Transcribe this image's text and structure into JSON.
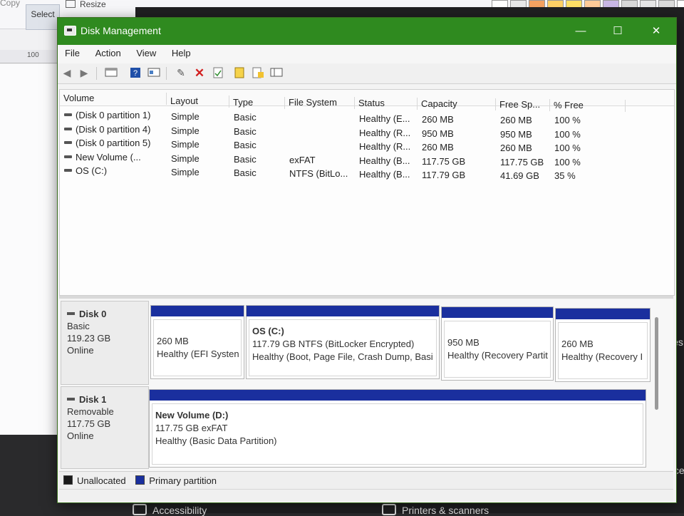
{
  "background_paint": {
    "copy_label": "Copy",
    "select_label": "Select",
    "resize_label": "Resize",
    "ruler_value": "100",
    "palette_colors": [
      "#ffffff",
      "#e9e9e9",
      "#f4a261",
      "#ffd166",
      "#ffe066",
      "#ffcc99",
      "#c9b8e6",
      "#d9d9d9",
      "#e6e6e6",
      "#dcdcdc",
      "#ffffff",
      "#b0b0b0"
    ]
  },
  "background_settings": {
    "side_text_1": "ices",
    "side_text_2": "evice",
    "bottom_item_1": "Accessibility",
    "bottom_item_2": "Printers & scanners"
  },
  "window": {
    "title": "Disk Management",
    "accent_color": "#2f8a1f",
    "icon": "disk-management-icon",
    "minimize": "—",
    "maximize": "☐",
    "close": "✕"
  },
  "menu": [
    "File",
    "Action",
    "View",
    "Help"
  ],
  "toolbar": {
    "icons": [
      "back-arrow-icon",
      "forward-arrow-icon",
      "console-tree-icon",
      "help-icon",
      "properties-icon",
      "connect-icon",
      "delete-icon",
      "check-icon",
      "new-icon",
      "open-icon",
      "list-icon"
    ]
  },
  "volumes": {
    "columns": [
      "Volume",
      "Layout",
      "Type",
      "File System",
      "Status",
      "Capacity",
      "Free Sp...",
      "% Free"
    ],
    "rows": [
      {
        "volume": "(Disk 0 partition 1)",
        "layout": "Simple",
        "type": "Basic",
        "fs": "",
        "status": "Healthy (E...",
        "capacity": "260 MB",
        "free": "260 MB",
        "pct": "100 %"
      },
      {
        "volume": "(Disk 0 partition 4)",
        "layout": "Simple",
        "type": "Basic",
        "fs": "",
        "status": "Healthy (R...",
        "capacity": "950 MB",
        "free": "950 MB",
        "pct": "100 %"
      },
      {
        "volume": "(Disk 0 partition 5)",
        "layout": "Simple",
        "type": "Basic",
        "fs": "",
        "status": "Healthy (R...",
        "capacity": "260 MB",
        "free": "260 MB",
        "pct": "100 %"
      },
      {
        "volume": "New Volume (...",
        "layout": "Simple",
        "type": "Basic",
        "fs": "exFAT",
        "status": "Healthy (B...",
        "capacity": "117.75 GB",
        "free": "117.75 GB",
        "pct": "100 %"
      },
      {
        "volume": "OS (C:)",
        "layout": "Simple",
        "type": "Basic",
        "fs": "NTFS (BitLo...",
        "status": "Healthy (B...",
        "capacity": "117.79 GB",
        "free": "41.69 GB",
        "pct": "35 %"
      }
    ]
  },
  "disks": [
    {
      "name": "Disk 0",
      "kind": "Basic",
      "size": "119.23 GB",
      "state": "Online",
      "partitions": [
        {
          "title": "",
          "line1": "260 MB",
          "line2": "Healthy (EFI Systen"
        },
        {
          "title": "OS  (C:)",
          "line1": "117.79 GB NTFS (BitLocker Encrypted)",
          "line2": "Healthy (Boot, Page File, Crash Dump, Basi"
        },
        {
          "title": "",
          "line1": "950 MB",
          "line2": "Healthy (Recovery Partit"
        },
        {
          "title": "",
          "line1": "260 MB",
          "line2": "Healthy (Recovery I"
        }
      ]
    },
    {
      "name": "Disk 1",
      "kind": "Removable",
      "size": "117.75 GB",
      "state": "Online",
      "partitions": [
        {
          "title": "New Volume  (D:)",
          "line1": "117.75 GB exFAT",
          "line2": "Healthy (Basic Data Partition)"
        }
      ]
    }
  ],
  "legend": [
    {
      "label": "Unallocated",
      "color": "#1a1a1a"
    },
    {
      "label": "Primary partition",
      "color": "#1a2f9e"
    }
  ]
}
